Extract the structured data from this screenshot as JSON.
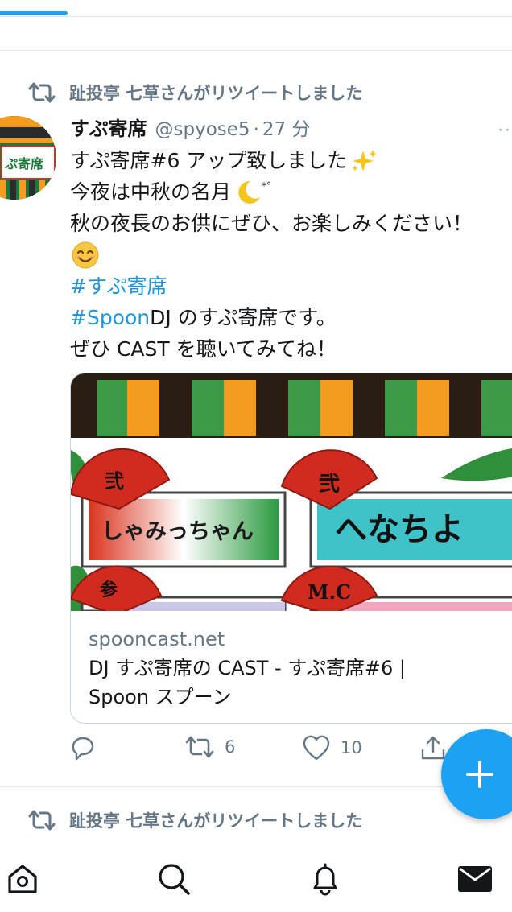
{
  "feed": {
    "tweet": {
      "retweet_context": "趾投亭 七草さんがリツイートしました",
      "display_name": "すぷ寄席",
      "handle": "@spyose5",
      "separator": "·",
      "time": "27 分",
      "more_caret": "··",
      "lines": {
        "l1": "すぷ寄席#6 アップ致しました",
        "l2": "今夜は中秋の名月",
        "l3": "秋の夜長のお供にぜひ、お楽しみください！",
        "hashtag1": "#すぷ寄席",
        "hashtag2": "#Spoon",
        "l6_rest": " DJ のすぷ寄席です。",
        "l7": "ぜひ CAST を聴いてみてね！"
      },
      "card": {
        "image_labels": {
          "fan1": "弐",
          "name1": "しゃみっちゃん",
          "fan2": "弐",
          "name2": "へなちよ",
          "fan3": "参",
          "fan4": "M.C"
        },
        "domain": "spooncast.net",
        "title_line1": "DJ すぷ寄席の CAST - すぷ寄席#6 |",
        "title_line2": "Spoon スプーン"
      },
      "actions": {
        "reply_count": "",
        "retweet_count": "6",
        "like_count": "10"
      }
    },
    "next_retweet_context": "趾投亭 七草さんがリツイートしました"
  },
  "icons": {
    "retweet": "retweet-icon",
    "reply": "reply-icon",
    "like": "heart-icon",
    "share": "share-icon",
    "compose": "plus-icon",
    "home": "home-icon",
    "search": "search-icon",
    "notifications": "bell-icon",
    "messages": "mail-icon"
  },
  "colors": {
    "accent": "#1da1f2",
    "hashtag": "#1b95e0",
    "muted": "#657786"
  }
}
